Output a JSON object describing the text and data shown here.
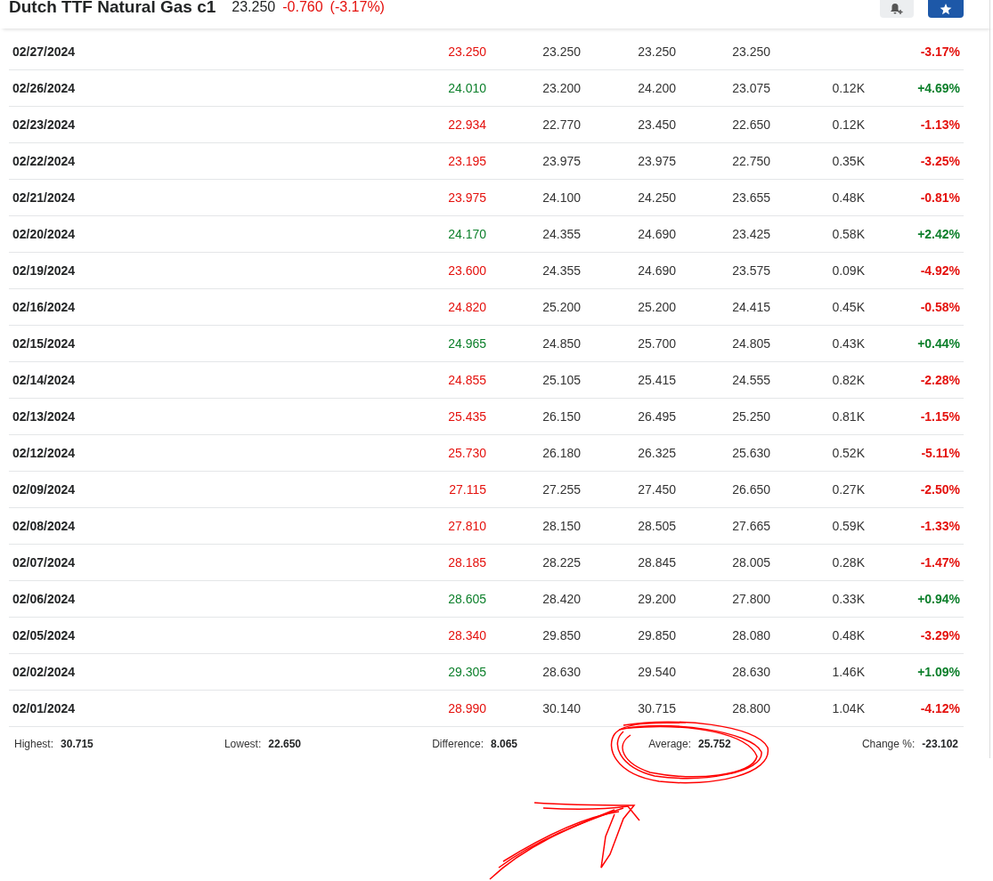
{
  "header": {
    "title": "Dutch TTF Natural Gas c1",
    "last": "23.250",
    "change": "-0.760",
    "change_pct": "(-3.17%)",
    "color": "#e4100c"
  },
  "rows": [
    {
      "date": "02/27/2024",
      "price": "23.250",
      "open": "23.250",
      "high": "23.250",
      "low": "23.250",
      "change": "-3.17%",
      "color": "#e4100c"
    },
    {
      "date": "02/26/2024",
      "price": "24.010",
      "open": "23.200",
      "high": "24.200",
      "low": "23.075",
      "volume": "0.12K",
      "change": "+4.69%",
      "color": "#0b7f2a"
    },
    {
      "date": "02/23/2024",
      "price": "22.934",
      "open": "22.770",
      "high": "23.450",
      "low": "22.650",
      "volume": "0.12K",
      "change": "-1.13%",
      "color": "#e4100c"
    },
    {
      "date": "02/22/2024",
      "price": "23.195",
      "open": "23.975",
      "high": "23.975",
      "low": "22.750",
      "volume": "0.35K",
      "change": "-3.25%",
      "color": "#e4100c"
    },
    {
      "date": "02/21/2024",
      "price": "23.975",
      "open": "24.100",
      "high": "24.250",
      "low": "23.655",
      "volume": "0.48K",
      "change": "-0.81%",
      "color": "#e4100c"
    },
    {
      "date": "02/20/2024",
      "price": "24.170",
      "open": "24.355",
      "high": "24.690",
      "low": "23.425",
      "volume": "0.58K",
      "change": "+2.42%",
      "color": "#0b7f2a"
    },
    {
      "date": "02/19/2024",
      "price": "23.600",
      "open": "24.355",
      "high": "24.690",
      "low": "23.575",
      "volume": "0.09K",
      "change": "-4.92%",
      "color": "#e4100c"
    },
    {
      "date": "02/16/2024",
      "price": "24.820",
      "open": "25.200",
      "high": "25.200",
      "low": "24.415",
      "volume": "0.45K",
      "change": "-0.58%",
      "color": "#e4100c"
    },
    {
      "date": "02/15/2024",
      "price": "24.965",
      "open": "24.850",
      "high": "25.700",
      "low": "24.805",
      "volume": "0.43K",
      "change": "+0.44%",
      "color": "#0b7f2a"
    },
    {
      "date": "02/14/2024",
      "price": "24.855",
      "open": "25.105",
      "high": "25.415",
      "low": "24.555",
      "volume": "0.82K",
      "change": "-2.28%",
      "color": "#e4100c"
    },
    {
      "date": "02/13/2024",
      "price": "25.435",
      "open": "26.150",
      "high": "26.495",
      "low": "25.250",
      "volume": "0.81K",
      "change": "-1.15%",
      "color": "#e4100c"
    },
    {
      "date": "02/12/2024",
      "price": "25.730",
      "open": "26.180",
      "high": "26.325",
      "low": "25.630",
      "volume": "0.52K",
      "change": "-5.11%",
      "color": "#e4100c"
    },
    {
      "date": "02/09/2024",
      "price": "27.115",
      "open": "27.255",
      "high": "27.450",
      "low": "26.650",
      "volume": "0.27K",
      "change": "-2.50%",
      "color": "#e4100c"
    },
    {
      "date": "02/08/2024",
      "price": "27.810",
      "open": "28.150",
      "high": "28.505",
      "low": "27.665",
      "volume": "0.59K",
      "change": "-1.33%",
      "color": "#e4100c"
    },
    {
      "date": "02/07/2024",
      "price": "28.185",
      "open": "28.225",
      "high": "28.845",
      "low": "28.005",
      "volume": "0.28K",
      "change": "-1.47%",
      "color": "#e4100c"
    },
    {
      "date": "02/06/2024",
      "price": "28.605",
      "open": "28.420",
      "high": "29.200",
      "low": "27.800",
      "volume": "0.33K",
      "change": "+0.94%",
      "color": "#0b7f2a"
    },
    {
      "date": "02/05/2024",
      "price": "28.340",
      "open": "29.850",
      "high": "29.850",
      "low": "28.080",
      "volume": "0.48K",
      "change": "-3.29%",
      "color": "#e4100c"
    },
    {
      "date": "02/02/2024",
      "price": "29.305",
      "open": "28.630",
      "high": "29.540",
      "low": "28.630",
      "volume": "1.46K",
      "change": "+1.09%",
      "color": "#0b7f2a"
    },
    {
      "date": "02/01/2024",
      "price": "28.990",
      "open": "30.140",
      "high": "30.715",
      "low": "28.800",
      "volume": "1.04K",
      "change": "-4.12%",
      "color": "#e4100c"
    }
  ],
  "summary": [
    {
      "label": "Highest:",
      "value": "30.715"
    },
    {
      "label": "Lowest:",
      "value": "22.650"
    },
    {
      "label": "Difference:",
      "value": "8.065"
    },
    {
      "label": "Average:",
      "value": "25.752"
    },
    {
      "label": "Change %:",
      "value": "-23.102"
    }
  ]
}
